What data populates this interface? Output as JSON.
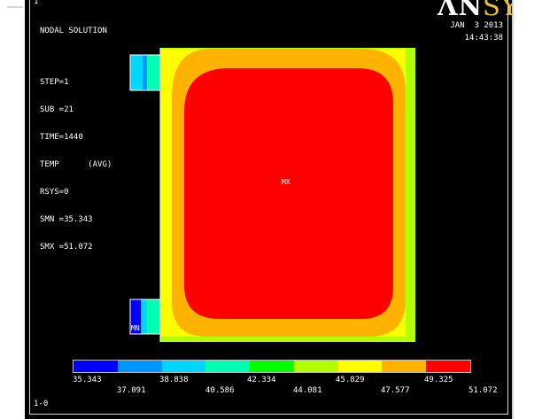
{
  "window": {
    "number": "1",
    "bottom_label": "1-0"
  },
  "info": {
    "lines": [
      "NODAL SOLUTION",
      "STEP=1",
      "SUB =21",
      "TIME=1440",
      "TEMP      (AVG)",
      "RSYS=0",
      "SMN =35.343",
      "SMX =51.072"
    ]
  },
  "logo": {
    "prefix": "ΛΝ",
    "suffix": "SYS"
  },
  "datetime": {
    "date": "JAN  3 2013",
    "time": "14:43:38"
  },
  "markers": {
    "max": "MX",
    "min": "MN"
  },
  "legend": {
    "colors": [
      "#0000ff",
      "#0096ff",
      "#00d6ff",
      "#00ffb3",
      "#00ff00",
      "#b3ff00",
      "#ffff00",
      "#ffb300",
      "#ff0000"
    ],
    "values_top": [
      "35.343",
      "38.838",
      "42.334",
      "45.829",
      "49.325"
    ],
    "values_bottom": [
      "37.091",
      "40.586",
      "44.081",
      "47.577",
      "51.072"
    ]
  },
  "model_colors": {
    "outer": "#b3ff00",
    "yellow": "#ffff00",
    "orange": "#ffb300",
    "core": "#ff0000",
    "fin_blue": "#0096ff",
    "fin_cyan": "#00d6ff",
    "fin_deep": "#0000ff"
  }
}
